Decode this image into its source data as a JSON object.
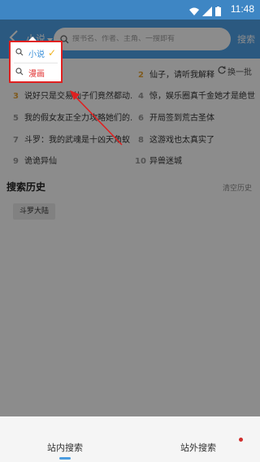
{
  "status_bar": {
    "time": "11:48"
  },
  "header": {
    "search_type": "小说",
    "search_placeholder": "搜书名、作者、主角、一搜即有",
    "search_value": "",
    "search_button": "搜索"
  },
  "hot": {
    "refresh_label": "换一批",
    "items": [
      {
        "rank": "1",
        "title": ""
      },
      {
        "rank": "2",
        "title": "仙子，请听我解释"
      },
      {
        "rank": "3",
        "title": "说好只是交易仙子们竟然都动..."
      },
      {
        "rank": "4",
        "title": "惊，娱乐圈真千金她才是绝世..."
      },
      {
        "rank": "5",
        "title": "我的假女友正全力攻略她们的..."
      },
      {
        "rank": "6",
        "title": "开局签到荒古圣体"
      },
      {
        "rank": "7",
        "title": "斗罗：我的武魂是十凶天角蚁"
      },
      {
        "rank": "8",
        "title": "这游戏也太真实了"
      },
      {
        "rank": "9",
        "title": "诡诡异仙"
      },
      {
        "rank": "10",
        "title": "异兽迷城"
      }
    ]
  },
  "history": {
    "title": "搜索历史",
    "clear_label": "清空历史",
    "items": [
      "斗罗大陆"
    ]
  },
  "dropdown": {
    "options": [
      {
        "label": "小说",
        "selected": true
      },
      {
        "label": "漫画",
        "selected": false
      }
    ]
  },
  "bottom_tabs": [
    {
      "label": "站内搜索",
      "active": true
    },
    {
      "label": "站外搜索",
      "active": false
    }
  ],
  "colors": {
    "accent": "#4fa3ea",
    "status_bar": "#3e86c4",
    "highlight_frame": "#e02020",
    "arrow": "#e02020",
    "rank_top": "#e8a63a"
  },
  "icons": [
    "back-arrow-icon",
    "dropdown-triangle-icon",
    "search-icon",
    "refresh-icon",
    "check-icon",
    "wifi-icon",
    "signal-icon",
    "battery-icon"
  ]
}
